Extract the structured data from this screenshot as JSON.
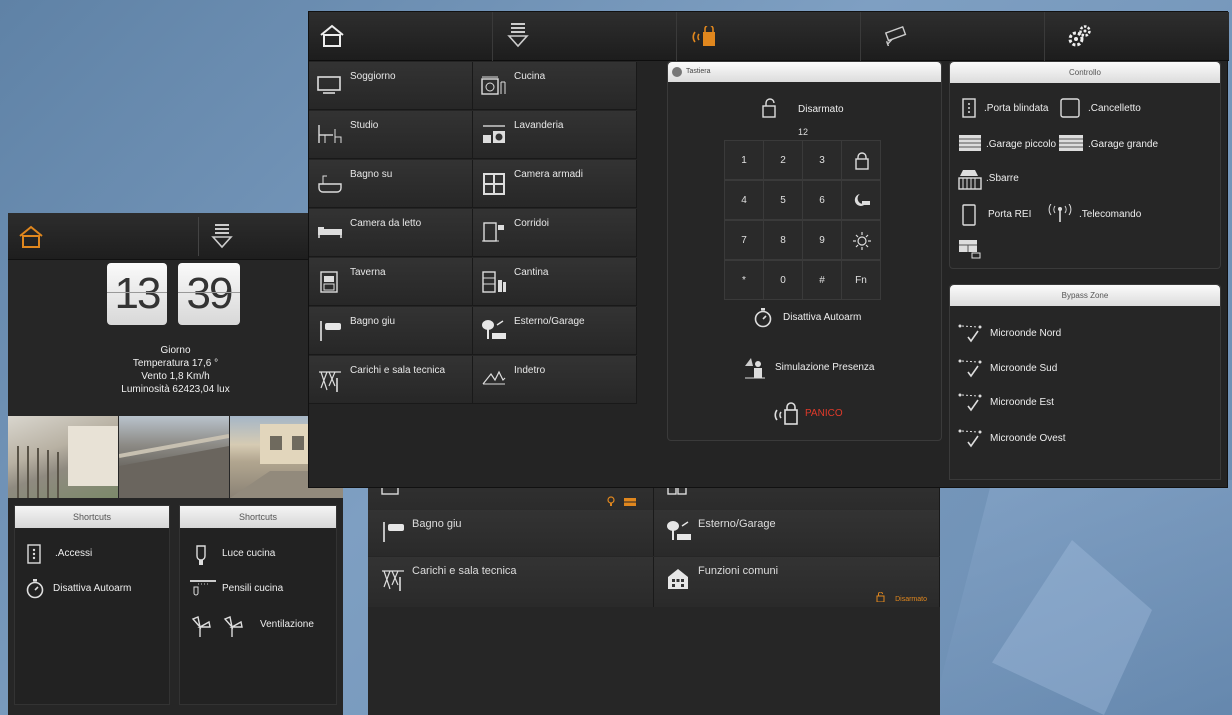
{
  "colors": {
    "accent": "#e0871e",
    "panic": "#e03a2a",
    "panel": "#262626",
    "header": "#e8e8e8"
  },
  "back_tablet": {
    "rows": [
      [
        {
          "label": "",
          "icon": "cabinet-icon",
          "badge": ""
        },
        {
          "label": "",
          "icon": "wardrobe-icon",
          "badge": ""
        }
      ],
      [
        {
          "label": "Bagno giu",
          "icon": "faucet-icon",
          "badge": ""
        },
        {
          "label": "Esterno/Garage",
          "icon": "garden-light-icon",
          "badge": ""
        }
      ],
      [
        {
          "label": "Carichi e sala tecnica",
          "icon": "load-icon",
          "badge": ""
        },
        {
          "label": "Funzioni comuni",
          "icon": "building-icon",
          "badge": "Disarmato"
        }
      ]
    ]
  },
  "left_tablet": {
    "clock": {
      "hours": "13",
      "minutes": "39"
    },
    "weather": {
      "period": "Giorno",
      "temperature": "Temperatura 17,6 °",
      "wind": "Vento 1,8 Km/h",
      "luminosity": "Luminosità 62423,04 lux"
    },
    "shortcuts_left": {
      "title": "Shortcuts",
      "items": [
        {
          "label": ".Accessi",
          "icon": "door-panel-icon"
        },
        {
          "label": "Disattiva Autoarm",
          "icon": "stopwatch-icon"
        }
      ]
    },
    "shortcuts_right": {
      "title": "Shortcuts",
      "items": [
        {
          "label": "Luce cucina",
          "icon": "light-bulb-icon"
        },
        {
          "label": "Pensili cucina",
          "icon": "spot-light-icon"
        },
        {
          "label": "Ventilazione",
          "icon": "fan-icon"
        }
      ]
    }
  },
  "main_tablet": {
    "nav": [
      "home-icon",
      "scenarios-icon",
      "alarm-icon",
      "camera-icon",
      "settings-icon"
    ],
    "rooms": [
      [
        "Soggiorno",
        "Cucina"
      ],
      [
        "Studio",
        "Lavanderia"
      ],
      [
        "Bagno su",
        "Camera armadi"
      ],
      [
        "Camera da letto",
        "Corridoi"
      ],
      [
        "Taverna",
        "Cantina"
      ],
      [
        "Bagno giu",
        "Esterno/Garage"
      ],
      [
        "Carichi e sala tecnica",
        "Indetro"
      ]
    ],
    "keypad": {
      "title": "Tastiera",
      "status": "Disarmato",
      "code": "12",
      "keys": [
        [
          "1",
          "2",
          "3",
          "lock"
        ],
        [
          "4",
          "5",
          "6",
          "night"
        ],
        [
          "7",
          "8",
          "9",
          "sun"
        ],
        [
          "*",
          "0",
          "#",
          "Fn"
        ]
      ],
      "disable_autoarm": "Disattiva Autoarm",
      "presence_sim": "Simulazione Presenza",
      "panic": "PANICO"
    },
    "controllo": {
      "title": "Controllo",
      "items": [
        {
          "label": ".Porta blindata",
          "icon": "armored-door-icon"
        },
        {
          "label": ".Cancelletto",
          "icon": "gate-icon"
        },
        {
          "label": ".Garage piccolo",
          "icon": "garage-small-icon"
        },
        {
          "label": ".Garage grande",
          "icon": "garage-large-icon"
        },
        {
          "label": ".Sbarre",
          "icon": "car-barrier-icon"
        },
        {
          "label": "Porta REI",
          "icon": "fire-door-icon"
        },
        {
          "label": ".Telecomando",
          "icon": "remote-signal-icon"
        }
      ]
    },
    "bypass": {
      "title": "Bypass Zone",
      "items": [
        "Microonde Nord",
        "Microonde Sud",
        "Microonde Est",
        "Microonde Ovest"
      ]
    }
  }
}
